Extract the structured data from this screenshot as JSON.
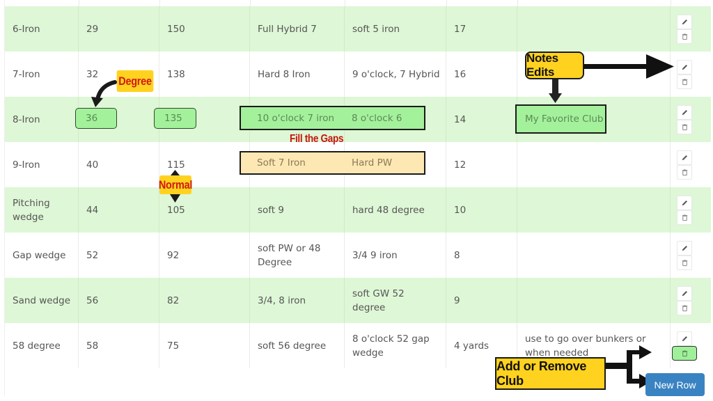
{
  "table": {
    "rows": [
      {
        "club": "6-Iron",
        "degree": "29",
        "normal": "150",
        "gap_high": "Full Hybrid 7",
        "gap_low": "soft 5 iron",
        "gap_yards": "17",
        "notes": ""
      },
      {
        "club": "7-Iron",
        "degree": "32",
        "normal": "138",
        "gap_high": "Hard 8 Iron",
        "gap_low": "9 o'clock, 7 Hybrid",
        "gap_yards": "16",
        "notes": ""
      },
      {
        "club": "8-Iron",
        "degree": "36",
        "normal": "135",
        "gap_high": "10 o'clock 7 iron",
        "gap_low": "8 o'clock 6",
        "gap_yards": "14",
        "notes": "My Favorite Club"
      },
      {
        "club": "9-Iron",
        "degree": "40",
        "normal": "115",
        "gap_high": "Soft 7 Iron",
        "gap_low": "Hard PW",
        "gap_yards": "12",
        "notes": ""
      },
      {
        "club": "Pitching wedge",
        "degree": "44",
        "normal": "105",
        "gap_high": "soft 9",
        "gap_low": "hard 48 degree",
        "gap_yards": "10",
        "notes": ""
      },
      {
        "club": "Gap wedge",
        "degree": "52",
        "normal": "92",
        "gap_high": "soft PW or 48 Degree",
        "gap_low": "3/4 9 iron",
        "gap_yards": "8",
        "notes": ""
      },
      {
        "club": "Sand wedge",
        "degree": "56",
        "normal": "82",
        "gap_high": "3/4, 8 iron",
        "gap_low": "soft GW 52 degree",
        "gap_yards": "9",
        "notes": ""
      },
      {
        "club": "58 degree",
        "degree": "58",
        "normal": "75",
        "gap_high": "soft 56 degree",
        "gap_low": "8 o'clock 52 gap wedge",
        "gap_yards": "4 yards",
        "notes": "use to go over bunkers or when needed"
      }
    ],
    "row_actions": {
      "edit_icon": "pencil-icon",
      "delete_icon": "trash-icon"
    }
  },
  "annotations": {
    "degree": "Degree",
    "normal": "Normal",
    "fill_gaps": "Fill the Gaps",
    "notes_edits": "Notes Edits",
    "add_remove": "Add or Remove Club"
  },
  "buttons": {
    "new_row": "New Row"
  },
  "colors": {
    "row_alt": "#def7d6",
    "highlight_green": "#a4f19c",
    "highlight_yellow": "#fde8b3",
    "callout_yellow": "#ffd21f",
    "callout_red_text": "#d01a10",
    "primary_button": "#3a83c2"
  }
}
